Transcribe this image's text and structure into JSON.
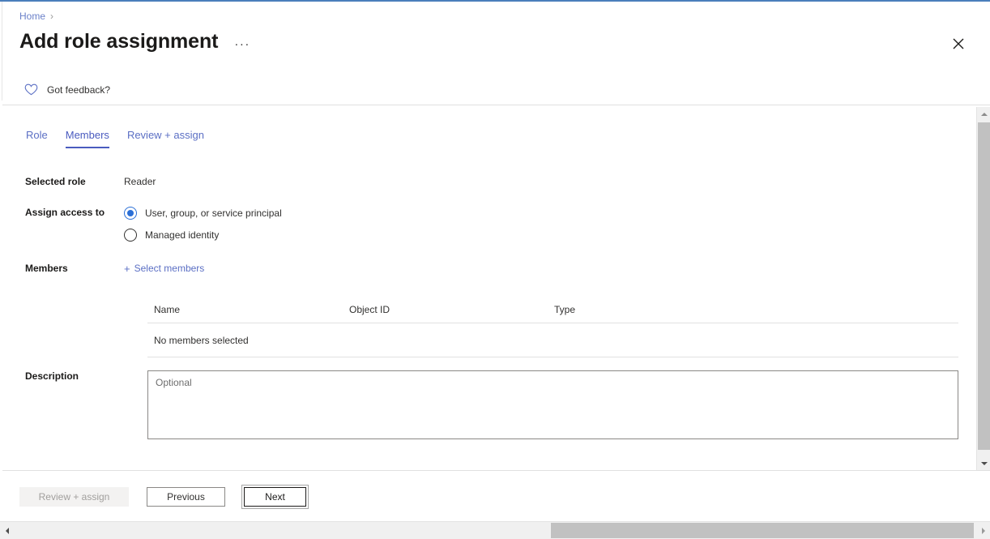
{
  "theme": {
    "accent_top": "#4a7ebb",
    "link_blue": "#5b6fc4",
    "tab_active_blue": "#4a5bbf",
    "radio_blue": "#2b6fd6",
    "text_primary": "#323130",
    "text_heading": "#1b1a19",
    "disabled_text": "#a19f9d",
    "disabled_bg": "#f3f2f1",
    "border": "#e0e0e0",
    "scrollbar_track": "#f0f0f0",
    "scrollbar_thumb": "#c1c1c1"
  },
  "breadcrumb": {
    "home_label": "Home",
    "separator": "›"
  },
  "header": {
    "title": "Add role assignment",
    "ellipsis_label": "···",
    "close_icon": "close-icon"
  },
  "feedback": {
    "icon": "heart-icon",
    "label": "Got feedback?"
  },
  "tabs": [
    {
      "label": "Role",
      "active": false
    },
    {
      "label": "Members",
      "active": true
    },
    {
      "label": "Review + assign",
      "active": false
    }
  ],
  "form": {
    "selected_role": {
      "label": "Selected role",
      "value": "Reader"
    },
    "assign_access_to": {
      "label": "Assign access to",
      "options": [
        {
          "label": "User, group, or service principal",
          "selected": true
        },
        {
          "label": "Managed identity",
          "selected": false
        }
      ]
    },
    "members": {
      "label": "Members",
      "select_link": "Select members",
      "plus_icon": "plus-icon",
      "table": {
        "columns": [
          "Name",
          "Object ID",
          "Type"
        ],
        "empty_message": "No members selected",
        "rows": []
      }
    },
    "description": {
      "label": "Description",
      "value": "",
      "placeholder": "Optional"
    }
  },
  "footer": {
    "buttons": [
      {
        "label": "Review + assign",
        "state": "disabled"
      },
      {
        "label": "Previous",
        "state": "enabled"
      },
      {
        "label": "Next",
        "state": "focused"
      }
    ]
  },
  "scrollbars": {
    "vertical": {
      "up_icon": "caret-up-icon",
      "down_icon": "caret-down-icon"
    },
    "horizontal": {
      "left_icon": "caret-left-icon",
      "right_icon": "caret-right-icon"
    }
  }
}
